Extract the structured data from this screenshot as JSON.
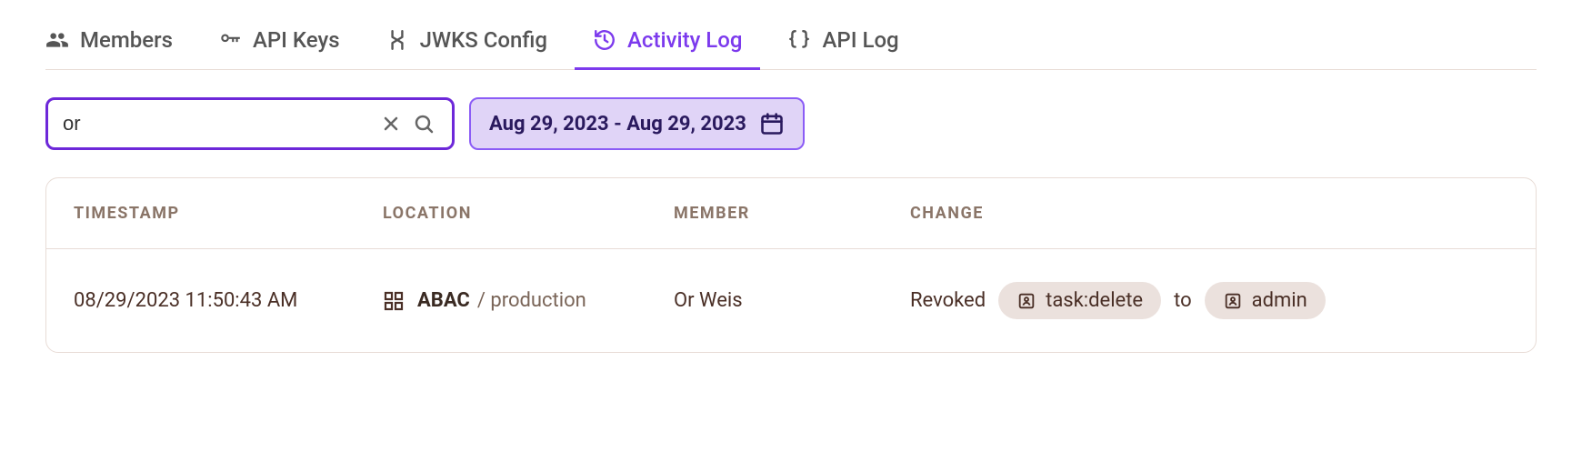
{
  "tabs": [
    {
      "id": "members",
      "label": "Members",
      "icon": "members-icon",
      "active": false
    },
    {
      "id": "apikeys",
      "label": "API Keys",
      "icon": "key-icon",
      "active": false
    },
    {
      "id": "jwks",
      "label": "JWKS Config",
      "icon": "jwks-icon",
      "active": false
    },
    {
      "id": "activity",
      "label": "Activity Log",
      "icon": "history-icon",
      "active": true
    },
    {
      "id": "apilog",
      "label": "API Log",
      "icon": "braces-icon",
      "active": false
    }
  ],
  "search": {
    "value": "or",
    "placeholder": ""
  },
  "date_range": {
    "label": "Aug 29, 2023 - Aug 29, 2023"
  },
  "columns": {
    "timestamp": "TIMESTAMP",
    "location": "LOCATION",
    "member": "MEMBER",
    "change": "CHANGE"
  },
  "rows": [
    {
      "timestamp": "08/29/2023 11:50:43 AM",
      "location_main": "ABAC",
      "location_sub": "/ production",
      "member": "Or Weis",
      "change": {
        "verb": "Revoked",
        "permission": "task:delete",
        "connector": "to",
        "role": "admin"
      }
    }
  ]
}
